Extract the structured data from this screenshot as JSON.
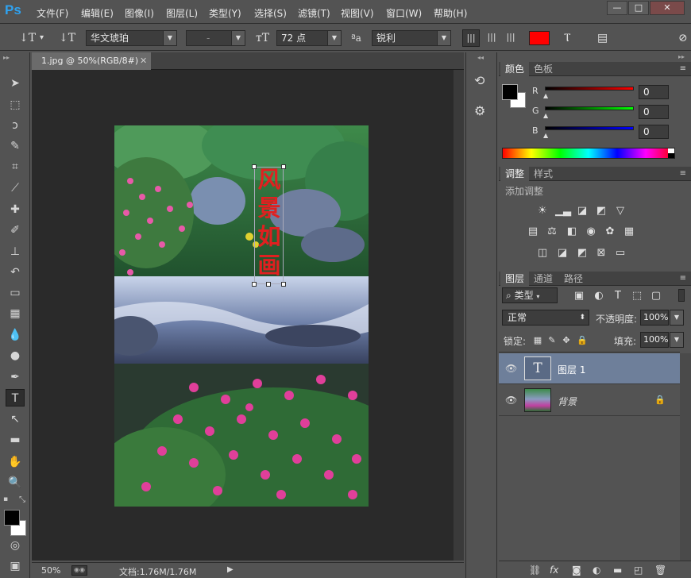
{
  "menubar": {
    "logo": "Ps",
    "items": [
      "文件(F)",
      "编辑(E)",
      "图像(I)",
      "图层(L)",
      "类型(Y)",
      "选择(S)",
      "滤镜(T)",
      "视图(V)",
      "窗口(W)",
      "帮助(H)"
    ],
    "window_buttons": [
      "—",
      "□",
      "✕"
    ]
  },
  "options": {
    "font_family": "华文琥珀",
    "font_style": "-",
    "font_size": "72 点",
    "aa_label": "ªa",
    "antialias": "锐利",
    "text_color": "#ff0000"
  },
  "document": {
    "tab_title": "1.jpg @ 50%(RGB/8#)",
    "tab_close": "✕",
    "canvas_text": [
      "风",
      "景",
      "如",
      "画"
    ],
    "text_color": "#e02020"
  },
  "status": {
    "zoom": "50%",
    "doc_info": "文档:1.76M/1.76M",
    "arrow": "▶"
  },
  "color_panel": {
    "tabs": [
      "颜色",
      "色板"
    ],
    "channels": [
      {
        "label": "R",
        "value": "0"
      },
      {
        "label": "G",
        "value": "0"
      },
      {
        "label": "B",
        "value": "0"
      }
    ]
  },
  "adjust_panel": {
    "tabs": [
      "调整",
      "样式"
    ],
    "title": "添加调整"
  },
  "layers_panel": {
    "tabs": [
      "图层",
      "通道",
      "路径"
    ],
    "filter_label": "类型",
    "blend_mode": "正常",
    "opacity_label": "不透明度:",
    "opacity": "100%",
    "lock_label": "锁定:",
    "fill_label": "填充:",
    "fill": "100%",
    "layers": [
      {
        "name": "图层 1",
        "type": "text",
        "thumb": "T",
        "selected": true
      },
      {
        "name": "背景",
        "type": "image",
        "locked": true,
        "selected": false
      }
    ],
    "bottom_icons": [
      "link-icon",
      "fx-icon",
      "mask-icon",
      "adjustment-icon",
      "folder-icon",
      "new-layer-icon",
      "trash-icon"
    ]
  },
  "icons": {
    "eye": "👁",
    "lock": "🔒",
    "menu": "≡",
    "collapse": "◂◂",
    "expand": "▸▸"
  }
}
